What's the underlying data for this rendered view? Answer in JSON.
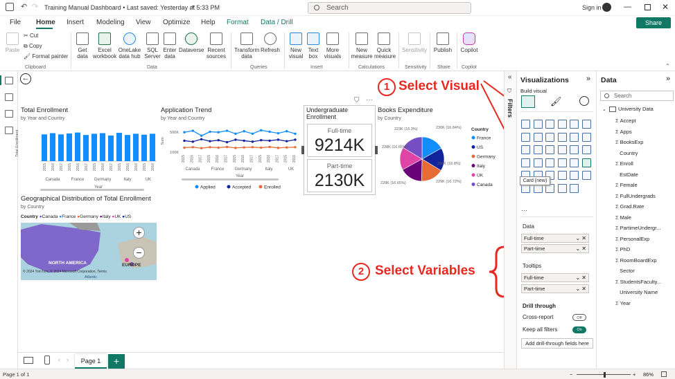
{
  "titlebar": {
    "title": "Training Manual Dashboard • Last saved: Yesterday at 5:33 PM",
    "search_placeholder": "Search",
    "signin": "Sign in"
  },
  "tabs": [
    "File",
    "Home",
    "Insert",
    "Modeling",
    "View",
    "Optimize",
    "Help",
    "Format",
    "Data / Drill"
  ],
  "share_label": "Share",
  "ribbon": {
    "clipboard": {
      "paste": "Paste",
      "cut": "Cut",
      "copy": "Copy",
      "format_painter": "Format painter",
      "group": "Clipboard"
    },
    "data": {
      "get_data": "Get data",
      "excel": "Excel workbook",
      "onelake": "OneLake data hub",
      "sql": "SQL Server",
      "enter": "Enter data",
      "dataverse": "Dataverse",
      "recent": "Recent sources",
      "group": "Data"
    },
    "queries": {
      "transform": "Transform data",
      "refresh": "Refresh",
      "group": "Queries"
    },
    "insert": {
      "new_visual": "New visual",
      "text_box": "Text box",
      "more_visuals": "More visuals",
      "group": "Insert"
    },
    "calculations": {
      "new_measure": "New measure",
      "quick_measure": "Quick measure",
      "group": "Calculations"
    },
    "sensitivity": {
      "label": "Sensitivity",
      "group": "Sensitivity"
    },
    "share": {
      "publish": "Publish",
      "group": "Share"
    },
    "copilot": {
      "label": "Copilot",
      "group": "Copilot"
    }
  },
  "charts": {
    "total_enrollment": {
      "title": "Total Enrollment",
      "subtitle": "by Year and Country",
      "ylabel": "Total Enrollment",
      "xlabel": "Year",
      "years": [
        "2015",
        "2016",
        "2017",
        "2015",
        "2016",
        "2017",
        "2015",
        "2016",
        "2017",
        "2015",
        "2016",
        "2016",
        "2015",
        "2016"
      ],
      "countries": [
        "Canada",
        "France",
        "Germany",
        "Italy",
        "UK"
      ]
    },
    "application_trend": {
      "title": "Application Trend",
      "subtitle": "by Year and Country",
      "ylabel": "Sum",
      "xlabel": "Year",
      "yticks": [
        "100K",
        "500K"
      ],
      "years": [
        "2015",
        "2016",
        "2017",
        "2015",
        "2016",
        "2017",
        "2015",
        "2016",
        "2017",
        "2015",
        "2016",
        "2017",
        "2015",
        "2016"
      ],
      "countries": [
        "Canada",
        "France",
        "Germany",
        "Italy",
        "UK"
      ],
      "legend": [
        "Applied",
        "Accepted",
        "Enrolled"
      ]
    },
    "books_expenditure": {
      "title": "Books Expenditure",
      "subtitle": "by Country",
      "labels": [
        "223K (16.3%)",
        "230K (16.84%)",
        "228K (16.65%)",
        "230K (16.8%)",
        "228K (16.65%)",
        "229K (16.72%)"
      ],
      "legend_title": "Country",
      "legend": [
        "France",
        "US",
        "Germany",
        "Italy",
        "UK",
        "Canada"
      ]
    },
    "geo": {
      "title": "Geographical Distribution of Total Enrollment",
      "subtitle": "by Country",
      "legend_title": "Country",
      "legend": [
        "Canada",
        "France",
        "Germany",
        "Italy",
        "UK",
        "US"
      ],
      "label_na": "NORTH AMERICA",
      "label_eu": "EUROPE",
      "label_atlantic": "Atlantic",
      "credit": "© 2024 TomTom, © 2024 Microsoft Corporation, Terms"
    }
  },
  "chart_data": [
    {
      "type": "bar",
      "title": "Total Enrollment",
      "categories": [
        "Canada 2015",
        "Canada 2016",
        "Canada 2017",
        "France 2015",
        "France 2016",
        "France 2017",
        "Germany 2015",
        "Germany 2016",
        "Germany 2017",
        "Italy 2015",
        "Italy 2016",
        "Italy 2016",
        "UK 2015",
        "UK 2016"
      ],
      "values": [
        0.88,
        0.92,
        0.88,
        0.91,
        0.94,
        0.86,
        0.9,
        0.92,
        0.84,
        0.93,
        0.86,
        0.9,
        0.87,
        0.9
      ]
    },
    {
      "type": "line",
      "title": "Application Trend",
      "ylabel": "Sum",
      "yticks": [
        "100K",
        "500K"
      ],
      "series": [
        {
          "name": "Applied",
          "values": [
            500,
            530,
            430,
            510,
            500,
            530,
            470,
            520,
            470,
            540,
            510,
            480,
            520,
            470
          ]
        },
        {
          "name": "Accepted",
          "values": [
            330,
            310,
            360,
            320,
            340,
            300,
            350,
            330,
            310,
            340,
            330,
            350,
            320,
            350
          ]
        },
        {
          "name": "Enrolled",
          "values": [
            190,
            200,
            180,
            200,
            190,
            205,
            185,
            195,
            200,
            190,
            205,
            185,
            195,
            200
          ]
        }
      ]
    },
    {
      "type": "pie",
      "title": "Books Expenditure",
      "categories": [
        "France",
        "US",
        "Germany",
        "Italy",
        "UK",
        "Canada"
      ],
      "values": [
        16.84,
        16.8,
        16.72,
        16.65,
        16.65,
        16.3
      ]
    }
  ],
  "card": {
    "title": "Undergraduate Enrollment",
    "fulltime_label": "Full-time",
    "fulltime_value": "9214K",
    "parttime_label": "Part-time",
    "parttime_value": "2130K"
  },
  "annotations": {
    "step1_num": "1",
    "step1_text": "Select Visual",
    "step2_num": "2",
    "step2_text": "Select Variables",
    "tooltip": "Card (new)"
  },
  "viz_pane": {
    "title": "Visualizations",
    "build_visual": "Build visual",
    "filters": "Filters",
    "data_label": "Data",
    "data_fields": [
      "Full-time",
      "Part-time"
    ],
    "tooltips_label": "Tooltips",
    "tooltip_fields": [
      "Full-time",
      "Part-time"
    ],
    "drill_through": "Drill through",
    "cross_report": "Cross-report",
    "cross_report_state": "Off",
    "keep_filters": "Keep all filters",
    "keep_filters_state": "On",
    "add_drill": "Add drill-through fields here",
    "more": "···"
  },
  "data_pane": {
    "title": "Data",
    "search_placeholder": "Search",
    "table": "University Data",
    "fields": [
      {
        "name": "Accept",
        "sigma": true,
        "checked": false
      },
      {
        "name": "Apps",
        "sigma": true,
        "checked": false
      },
      {
        "name": "BooksExp",
        "sigma": true,
        "checked": false
      },
      {
        "name": "Country",
        "sigma": false,
        "checked": false
      },
      {
        "name": "Enroll",
        "sigma": true,
        "checked": false
      },
      {
        "name": "EstDate",
        "sigma": false,
        "checked": false
      },
      {
        "name": "Female",
        "sigma": true,
        "checked": false
      },
      {
        "name": "FullUndergrads",
        "sigma": true,
        "checked": true
      },
      {
        "name": "Grad.Rate",
        "sigma": true,
        "checked": false
      },
      {
        "name": "Male",
        "sigma": true,
        "checked": false
      },
      {
        "name": "PartimeUndergr...",
        "sigma": true,
        "checked": true
      },
      {
        "name": "PersonalExp",
        "sigma": true,
        "checked": false
      },
      {
        "name": "PhD",
        "sigma": true,
        "checked": false
      },
      {
        "name": "RoomBoardExp",
        "sigma": true,
        "checked": false
      },
      {
        "name": "Sector",
        "sigma": false,
        "checked": false
      },
      {
        "name": "StudentsFaculty...",
        "sigma": true,
        "checked": false
      },
      {
        "name": "University Name",
        "sigma": false,
        "checked": false
      },
      {
        "name": "Year",
        "sigma": true,
        "checked": false
      }
    ]
  },
  "pages": {
    "page1": "Page 1",
    "add": "+"
  },
  "status": {
    "page_of": "Page 1 of 1",
    "zoom": "86%"
  },
  "colors": {
    "accent": "#117865",
    "bar": "#118dff",
    "annotation": "#e8281f"
  }
}
